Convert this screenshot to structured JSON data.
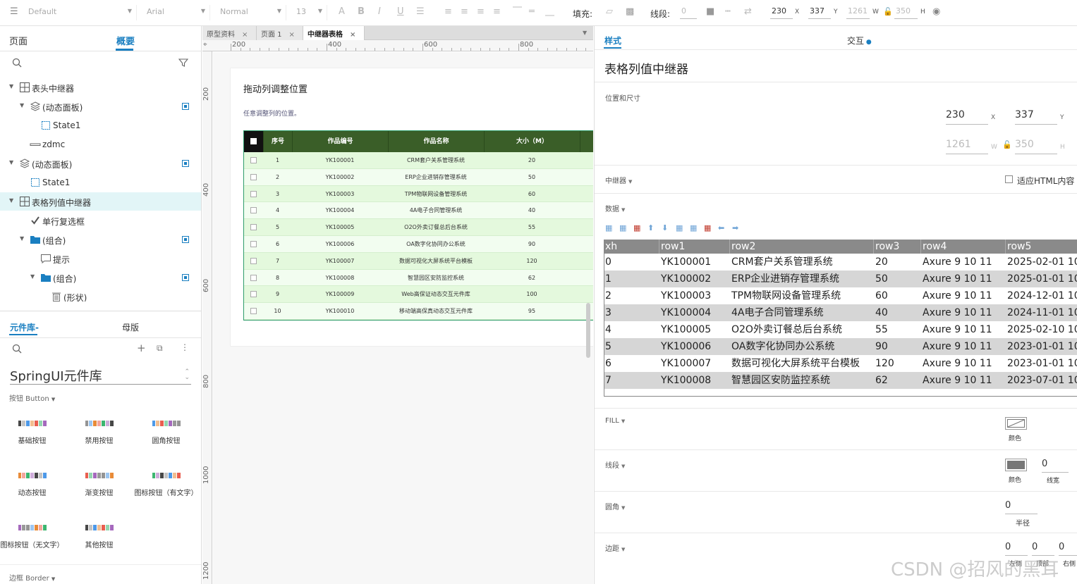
{
  "toolbar": {
    "style_select": "Default",
    "font_select": "Arial",
    "weight_select": "Normal",
    "size_select": "13",
    "fill_label": "填充:",
    "stroke_label": "线段:",
    "stroke_value": "0",
    "x": "230",
    "x_unit": "X",
    "y": "337",
    "y_unit": "Y",
    "w": "1261",
    "w_unit": "W",
    "h": "350",
    "h_unit": "H"
  },
  "left": {
    "tab_pages": "页面",
    "tab_outline": "概要",
    "tree": [
      {
        "label": "表头中继器",
        "depth": 0,
        "icon": "repeater-icon",
        "arrow": true,
        "vis": false
      },
      {
        "label": "(动态面板)",
        "depth": 1,
        "icon": "dynamic-panel-icon",
        "arrow": true,
        "vis": true
      },
      {
        "label": "State1",
        "depth": 2,
        "icon": "state-icon",
        "arrow": false,
        "vis": false
      },
      {
        "label": "zdmc",
        "depth": 1,
        "icon": "line-icon",
        "arrow": false,
        "vis": false
      },
      {
        "label": "(动态面板)",
        "depth": 0,
        "icon": "dynamic-panel-icon",
        "arrow": true,
        "vis": true
      },
      {
        "label": "State1",
        "depth": 1,
        "icon": "state-icon",
        "arrow": false,
        "vis": false
      },
      {
        "label": "表格列值中继器",
        "depth": 0,
        "icon": "repeater-icon",
        "arrow": true,
        "vis": false,
        "selected": true
      },
      {
        "label": "单行复选框",
        "depth": 1,
        "icon": "checkbox-icon",
        "arrow": false,
        "vis": false
      },
      {
        "label": "(组合)",
        "depth": 1,
        "icon": "folder-icon",
        "arrow": true,
        "vis": true
      },
      {
        "label": "提示",
        "depth": 2,
        "icon": "tooltip-icon",
        "arrow": false,
        "vis": false
      },
      {
        "label": "(组合)",
        "depth": 2,
        "icon": "folder-icon",
        "arrow": true,
        "vis": true
      },
      {
        "label": "(形状)",
        "depth": 3,
        "icon": "trash-icon",
        "arrow": false,
        "vis": false
      }
    ],
    "lib_tab": "元件库-",
    "master_tab": "母版",
    "library_name": "SpringUI元件库",
    "button_section": "按钮 Button",
    "border_section": "边框 Border",
    "lib_items": [
      "基础按钮",
      "禁用按钮",
      "圆角按钮",
      "动态按钮",
      "渐变按钮",
      "图标按钮（有文字）",
      "图标按钮（无文字）",
      "其他按钮"
    ]
  },
  "tabs": [
    {
      "label": "原型资料"
    },
    {
      "label": "页面 1"
    },
    {
      "label": "中继器表格"
    }
  ],
  "ruler": {
    "h": [
      "200",
      "400",
      "600",
      "800"
    ],
    "v": [
      "200",
      "400",
      "600",
      "800",
      "1000",
      "1200"
    ]
  },
  "artboard": {
    "title": "拖动列调整位置",
    "subtitle": "任意调整列的位置。",
    "headers": [
      "序号",
      "作品编号",
      "作品名称",
      "大小（M）"
    ],
    "rows": [
      [
        "1",
        "YK100001",
        "CRM套户关系管理系统",
        "20"
      ],
      [
        "2",
        "YK100002",
        "ERP企业进销存管理系统",
        "50"
      ],
      [
        "3",
        "YK100003",
        "TPM物联网设备管理系统",
        "60"
      ],
      [
        "4",
        "YK100004",
        "4A电子合同管理系统",
        "40"
      ],
      [
        "5",
        "YK100005",
        "O2O外卖订餐总后台系统",
        "55"
      ],
      [
        "6",
        "YK100006",
        "OA数字化协同办公系统",
        "90"
      ],
      [
        "7",
        "YK100007",
        "数据可视化大屏系统平台模板",
        "120"
      ],
      [
        "8",
        "YK100008",
        "智慧园区安防监控系统",
        "62"
      ],
      [
        "9",
        "YK100009",
        "Web高保证动态交互元件库",
        "100"
      ],
      [
        "10",
        "YK100010",
        "移动端高保真动态交互元件库",
        "95"
      ]
    ]
  },
  "right": {
    "tab_style": "样式",
    "tab_interact": "交互",
    "title": "表格列值中继器",
    "pos_size_label": "位置和尺寸",
    "x": "230",
    "x_unit": "X",
    "y": "337",
    "y_unit": "Y",
    "w": "1261",
    "w_unit": "W",
    "h": "350",
    "h_unit": "H",
    "repeater_label": "中继器",
    "fit_html": "适应HTML内容",
    "data_label": "数据",
    "table_headers": [
      "xh",
      "row1",
      "row2",
      "row3",
      "row4",
      "row5"
    ],
    "table_rows": [
      [
        "0",
        "YK100001",
        "CRM套户关系管理系统",
        "20",
        "Axure 9 10 11",
        "2025-02-01 10"
      ],
      [
        "1",
        "YK100002",
        "ERP企业进销存管理系统",
        "50",
        "Axure 9 10 11",
        "2025-01-01 10"
      ],
      [
        "2",
        "YK100003",
        "TPM物联网设备管理系统",
        "60",
        "Axure 9 10 11",
        "2024-12-01 10"
      ],
      [
        "3",
        "YK100004",
        "4A电子合同管理系统",
        "40",
        "Axure 9 10 11",
        "2024-11-01 10"
      ],
      [
        "4",
        "YK100005",
        "O2O外卖订餐总后台系统",
        "55",
        "Axure 9 10 11",
        "2025-02-10 10"
      ],
      [
        "5",
        "YK100006",
        "OA数字化协同办公系统",
        "90",
        "Axure 9 10 11",
        "2023-01-01 10"
      ],
      [
        "6",
        "YK100007",
        "数据可视化大屏系统平台模板",
        "120",
        "Axure 9 10 11",
        "2023-01-01 10"
      ],
      [
        "7",
        "YK100008",
        "智慧园区安防监控系统",
        "62",
        "Axure 9 10 11",
        "2023-07-01 10"
      ]
    ],
    "fill_label": "FILL",
    "fill_color_label": "颜色",
    "stroke_label": "线段",
    "stroke_color_label": "颜色",
    "stroke_width": "0",
    "stroke_width_label": "线宽",
    "radius_label": "圆角",
    "radius_value": "0",
    "radius_unit": "半径",
    "padding_label": "边距",
    "pad_values": [
      "0",
      "0",
      "0"
    ],
    "pad_labels": [
      "左侧",
      "顶部",
      "右侧"
    ]
  },
  "watermark": "CSDN @招风的黑耳"
}
